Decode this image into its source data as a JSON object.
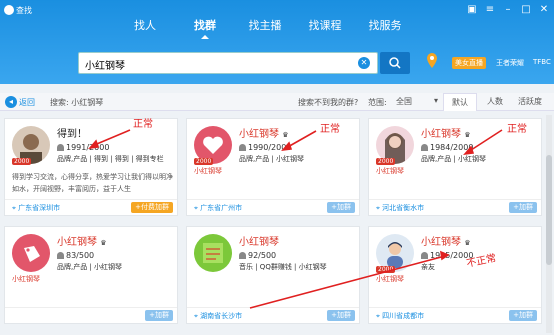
{
  "window": {
    "title": "查找"
  },
  "tabs": [
    {
      "label": "找人"
    },
    {
      "label": "找群"
    },
    {
      "label": "找主播"
    },
    {
      "label": "找课程"
    },
    {
      "label": "找服务"
    }
  ],
  "search": {
    "value": "小红钢琴",
    "live_label": "美女直播",
    "link1": "王者荣耀",
    "link2": "TFBC"
  },
  "toolbar": {
    "back": "返回",
    "crumb": "搜索: 小红钢琴",
    "notfound": "搜索不到我的群?",
    "range_label": "范围:",
    "range_value": "全国",
    "sort": [
      "默认",
      "人数",
      "活跃度"
    ]
  },
  "cards": [
    {
      "name": "得到！",
      "members": "1991/2000",
      "tags": "品牌,产品 | 得到 | 得到 | 得到专栏",
      "desc": "得到学习交流，心得分享，热爱学习让我们得以明净如水，开阔视野，丰富阅历，益于人生",
      "location": "广东省深圳市",
      "button": "+付费加群",
      "badge": "2000"
    },
    {
      "name": "小红钢琴",
      "members": "1990/2000",
      "tags": "品牌,产品 | 小红钢琴",
      "avatar_label": "小红钢琴",
      "location": "广东省广州市",
      "button": "+加群",
      "badge": "2000"
    },
    {
      "name": "小红钢琴",
      "members": "1984/2000",
      "tags": "品牌,产品 | 小红钢琴",
      "avatar_label": "小红钢琴",
      "location": "河北省衡水市",
      "button": "+加群",
      "badge": "2000"
    },
    {
      "name": "小红钢琴",
      "members": "83/500",
      "tags": "品牌,产品 | 小红钢琴",
      "avatar_label": "小红钢琴",
      "location": "",
      "button": "+加群"
    },
    {
      "name": "小红钢琴",
      "members": "92/500",
      "tags": "音乐 | QQ群赚钱 | 小红钢琴",
      "location": "湖南省长沙市",
      "button": "+加群"
    },
    {
      "name": "小红钢琴",
      "members": "1995/2000",
      "tags": "亲友",
      "avatar_label": "小红钢琴",
      "location": "四川省成都市",
      "button": "+加群",
      "badge": "2000"
    }
  ],
  "annotations": {
    "normal": "正常",
    "abnormal": "不正常"
  }
}
